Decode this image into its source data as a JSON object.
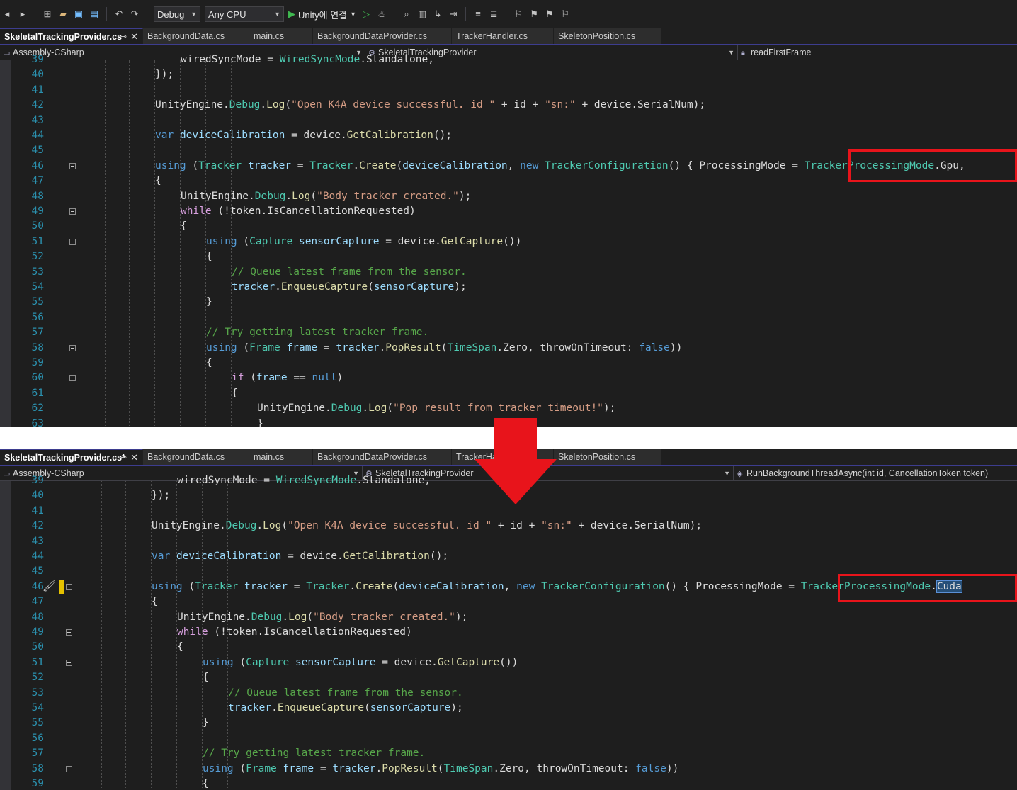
{
  "toolbar": {
    "config": "Debug",
    "platform": "Any CPU",
    "run_label": "Unity에 연결",
    "icons": [
      "back-icon",
      "forward-icon",
      "new-project-icon",
      "open-icon",
      "save-icon",
      "save-all-icon",
      "undo-icon",
      "redo-icon",
      "play-icon",
      "play-no-debug-icon",
      "hot-reload-icon",
      "find-icon",
      "layout-icon",
      "step-icon",
      "indent-icon",
      "comment-icon",
      "uncomment-icon",
      "bookmark-icon",
      "bookmark-prev-icon",
      "bookmark-next-icon",
      "bookmark-clear-icon"
    ]
  },
  "top_pane": {
    "tabs": [
      {
        "label": "SkeletalTrackingProvider.cs",
        "active": true
      },
      {
        "label": "BackgroundData.cs"
      },
      {
        "label": "main.cs"
      },
      {
        "label": "BackgroundDataProvider.cs"
      },
      {
        "label": "TrackerHandler.cs"
      },
      {
        "label": "SkeletonPosition.cs"
      }
    ],
    "nav": {
      "project": "Assembly-CSharp",
      "class": "SkeletalTrackingProvider",
      "member": "readFirstFrame"
    },
    "highlight": "TrackerProcessingMode.Gpu,"
  },
  "bottom_pane": {
    "tabs": [
      {
        "label": "SkeletalTrackingProvider.cs*",
        "active": true
      },
      {
        "label": "BackgroundData.cs"
      },
      {
        "label": "main.cs"
      },
      {
        "label": "BackgroundDataProvider.cs"
      },
      {
        "label": "TrackerHa"
      },
      {
        "label": "SkeletonPosition.cs"
      }
    ],
    "nav": {
      "project": "Assembly-CSharp",
      "class": "SkeletalTrackingProvider",
      "member": "RunBackgroundThreadAsync(int id, CancellationToken token)"
    },
    "highlight": "TrackerProcessingMode.Cuda"
  },
  "code_lines": {
    "39": "wiredSyncMode = WiredSyncMode.Standalone,",
    "40": "});",
    "41": "",
    "42": "UnityEngine.Debug.Log(\"Open K4A device successful. id \" + id + \"sn:\" + device.SerialNum);",
    "43": "",
    "44": "var deviceCalibration = device.GetCalibration();",
    "45": "",
    "46_top": "using (Tracker tracker = Tracker.Create(deviceCalibration, new TrackerConfiguration() { ProcessingMode = TrackerProcessingMode.Gpu,",
    "46_bottom": "using (Tracker tracker = Tracker.Create(deviceCalibration, new TrackerConfiguration() { ProcessingMode = TrackerProcessingMode.Cuda",
    "47": "{",
    "48": "UnityEngine.Debug.Log(\"Body tracker created.\");",
    "49": "while (!token.IsCancellationRequested)",
    "50": "{",
    "51": "using (Capture sensorCapture = device.GetCapture())",
    "52": "{",
    "53": "// Queue latest frame from the sensor.",
    "54": "tracker.EnqueueCapture(sensorCapture);",
    "55": "}",
    "56": "",
    "57": "// Try getting latest tracker frame.",
    "58": "using (Frame frame = tracker.PopResult(TimeSpan.Zero, throwOnTimeout: false))",
    "59": "{",
    "60": "if (frame == null)",
    "61": "{",
    "62": "UnityEngine.Debug.Log(\"Pop result from tracker timeout!\");",
    "63": "}"
  },
  "line_numbers_top": [
    "39",
    "40",
    "41",
    "42",
    "43",
    "44",
    "45",
    "46",
    "47",
    "48",
    "49",
    "50",
    "51",
    "52",
    "53",
    "54",
    "55",
    "56",
    "57",
    "58",
    "59",
    "60",
    "61",
    "62",
    "63"
  ],
  "line_numbers_bottom": [
    "39",
    "40",
    "41",
    "42",
    "43",
    "44",
    "45",
    "46",
    "47",
    "48",
    "49",
    "50",
    "51",
    "52",
    "53",
    "54",
    "55",
    "56",
    "57",
    "58",
    "59"
  ],
  "colors": {
    "annotation_red": "#e8141b",
    "editor_bg": "#1e1e1e",
    "keyword": "#569cd6",
    "type": "#4ec9b0",
    "string": "#d69d85",
    "comment": "#57a64a"
  }
}
